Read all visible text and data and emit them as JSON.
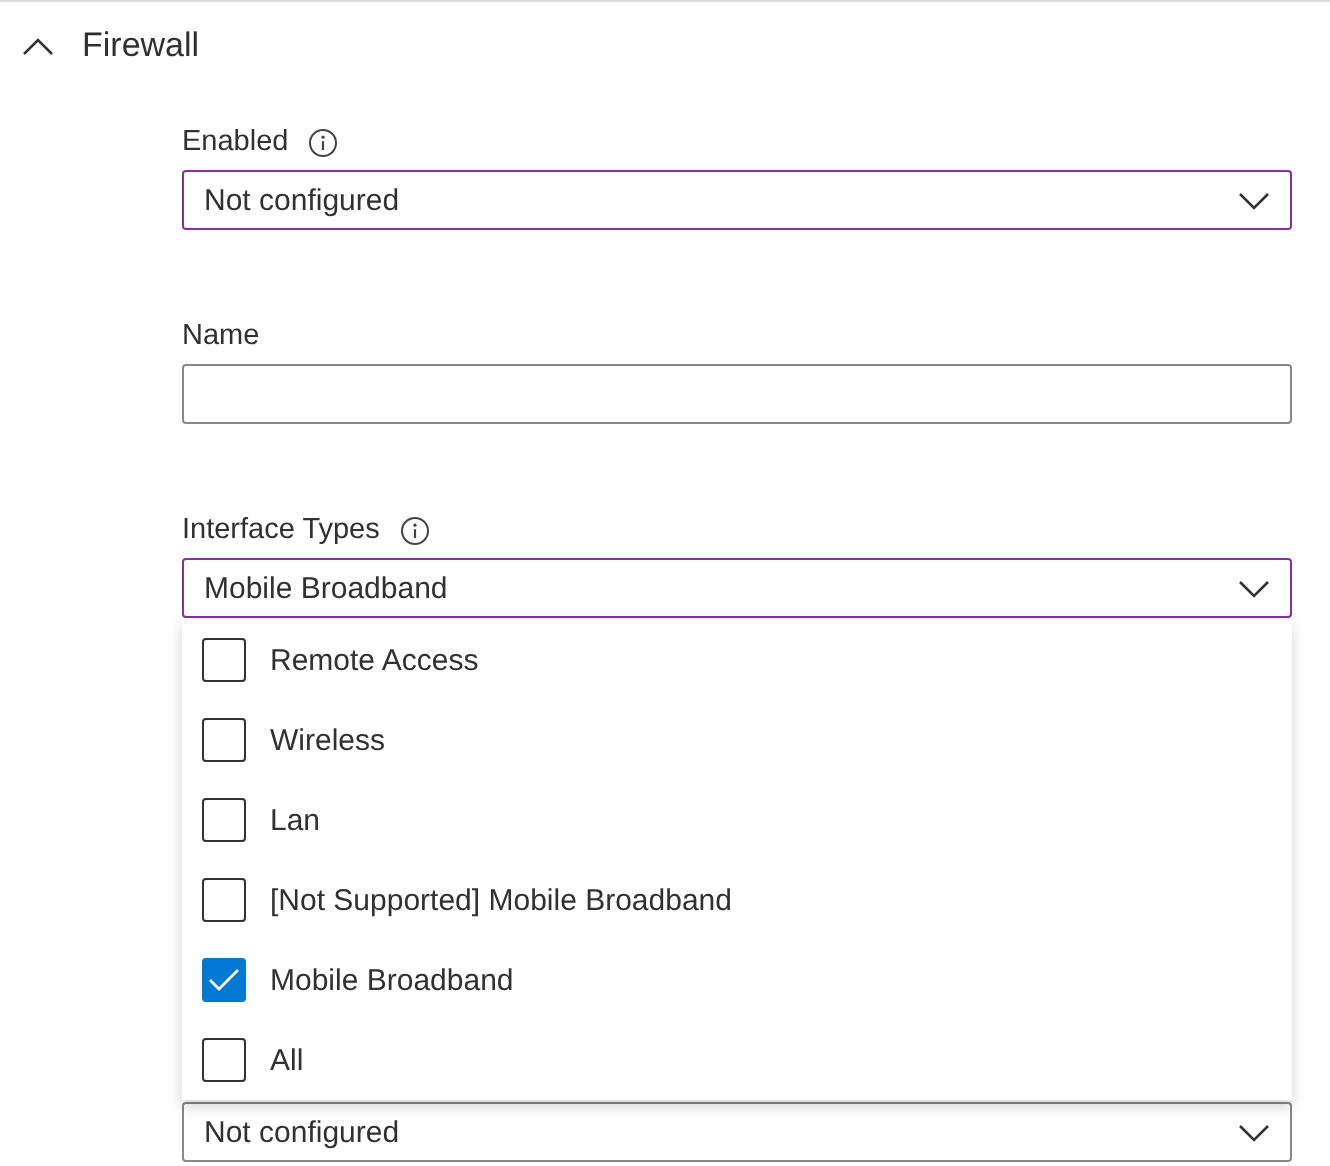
{
  "section": {
    "title": "Firewall",
    "expanded": true
  },
  "fields": [
    {
      "kind": "select",
      "label": "Enabled",
      "info": true,
      "highlighted": true,
      "value": "Not configured"
    },
    {
      "kind": "text",
      "label": "Name",
      "highlighted": false
    },
    {
      "kind": "select",
      "label": "Interface Types",
      "info": true,
      "highlighted": true,
      "value": "Mobile Broadband",
      "open": true,
      "options": [
        {
          "label": "Remote Access",
          "checked": false
        },
        {
          "label": "Wireless",
          "checked": false
        },
        {
          "label": "Lan",
          "checked": false
        },
        {
          "label": "[Not Supported] Mobile Broadband",
          "checked": false
        },
        {
          "label": "Mobile Broadband",
          "checked": true
        },
        {
          "label": "All",
          "checked": false
        }
      ]
    },
    {
      "kind": "select",
      "value": "Not configured"
    }
  ]
}
